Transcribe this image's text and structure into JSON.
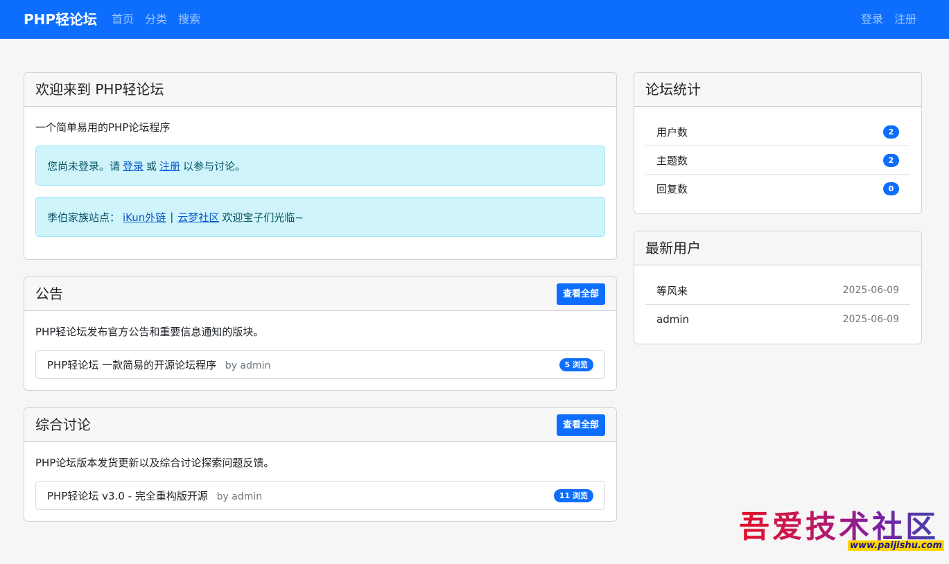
{
  "nav": {
    "brand": "PHP轻论坛",
    "links": [
      "首页",
      "分类",
      "搜索"
    ],
    "login": "登录",
    "register": "注册"
  },
  "welcome": {
    "title": "欢迎来到 PHP轻论坛",
    "desc": "一个简单易用的PHP论坛程序",
    "alert1_pre": "您尚未登录。请",
    "alert1_login": "登录",
    "alert1_or": "或",
    "alert1_register": "注册",
    "alert1_post": "以参与讨论。",
    "alert2_pre": "季伯家族站点：",
    "alert2_link1": "iKun外链",
    "alert2_sep": "|",
    "alert2_link2": "云梦社区",
    "alert2_post": "欢迎宝子们光临~"
  },
  "announce": {
    "title": "公告",
    "view_all": "查看全部",
    "desc": "PHP轻论坛发布官方公告和重要信息通知的版块。",
    "topic_title": "PHP轻论坛 一款简易的开源论坛程序",
    "topic_by": "by admin",
    "topic_views": "5 浏览"
  },
  "discuss": {
    "title": "综合讨论",
    "view_all": "查看全部",
    "desc": "PHP论坛版本发货更新以及综合讨论探索问题反馈。",
    "topic_title": "PHP轻论坛 v3.0 - 完全重构版开源",
    "topic_by": "by admin",
    "topic_views": "11 浏览"
  },
  "stats": {
    "title": "论坛统计",
    "items": [
      {
        "label": "用户数",
        "value": "2"
      },
      {
        "label": "主题数",
        "value": "2"
      },
      {
        "label": "回复数",
        "value": "0"
      }
    ]
  },
  "newusers": {
    "title": "最新用户",
    "items": [
      {
        "name": "等风来",
        "date": "2025-06-09"
      },
      {
        "name": "admin",
        "date": "2025-06-09"
      }
    ]
  },
  "watermark": {
    "text": "吾爱技术社区",
    "url": "www.paijishu.com"
  },
  "colors": {
    "primary": "#0d6efd",
    "alert_bg": "#cff4fc"
  }
}
